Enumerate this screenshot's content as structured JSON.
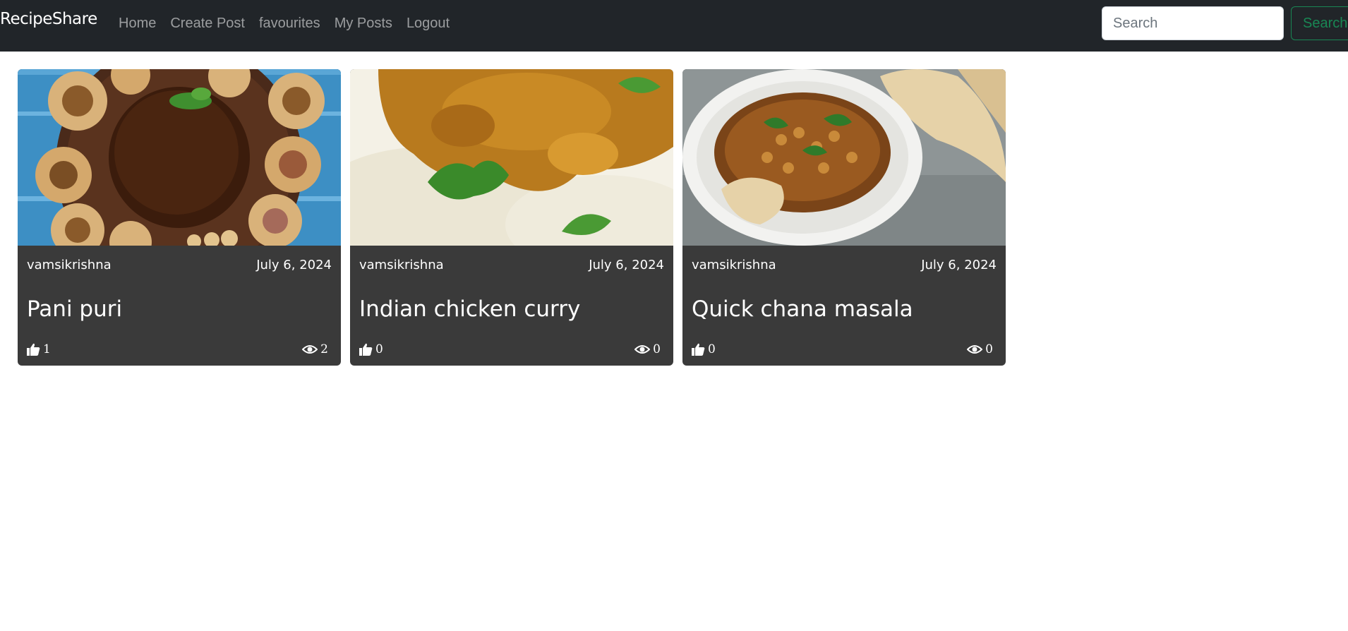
{
  "navbar": {
    "brand": "RecipeShare",
    "links": [
      "Home",
      "Create Post",
      "favourites",
      "My Posts",
      "Logout"
    ],
    "search": {
      "placeholder": "Search",
      "value": ""
    },
    "search_button": "Search"
  },
  "posts": [
    {
      "author": "vamsikrishna",
      "date": "July 6, 2024",
      "title": "Pani puri",
      "likes": "1",
      "views": "2"
    },
    {
      "author": "vamsikrishna",
      "date": "July 6, 2024",
      "title": "Indian chicken curry",
      "likes": "0",
      "views": "0"
    },
    {
      "author": "vamsikrishna",
      "date": "July 6, 2024",
      "title": "Quick chana masala",
      "likes": "0",
      "views": "0"
    }
  ],
  "icons": {
    "like": "thumbs-up-icon",
    "views": "eye-icon"
  },
  "colors": {
    "navbar_bg": "#212529",
    "card_bg": "#3a3a3a",
    "search_accent": "#198754"
  }
}
